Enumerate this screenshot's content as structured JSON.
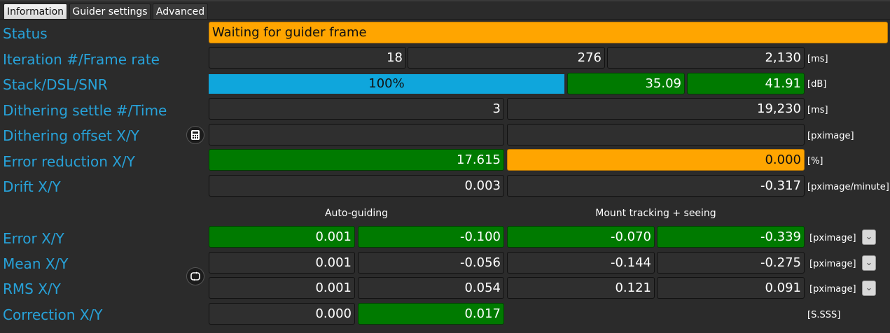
{
  "tabs": [
    "Information",
    "Guider settings",
    "Advanced"
  ],
  "labels": {
    "status": "Status",
    "iteration": "Iteration #/Frame rate",
    "stack": "Stack/DSL/SNR",
    "dither_settle": "Dithering settle #/Time",
    "dither_offset": "Dithering offset X/Y",
    "error_reduction": "Error reduction X/Y",
    "drift": "Drift X/Y",
    "error": "Error X/Y",
    "mean": "Mean X/Y",
    "rms": "RMS X/Y",
    "correction": "Correction X/Y"
  },
  "status_text": "Waiting for guider frame",
  "iteration": {
    "iteration": "18",
    "frame": "276",
    "time": "2,130",
    "unit": "[ms]"
  },
  "stack": {
    "progress_text": "100%",
    "progress_fraction": 1.0,
    "dsl": "35.09",
    "snr": "41.91",
    "unit": "[dB]"
  },
  "dither_settle": {
    "count": "3",
    "time": "19,230",
    "unit": "[ms]"
  },
  "dither_offset": {
    "x": "",
    "y": "",
    "unit": "[pximage]"
  },
  "error_reduction": {
    "x": "17.615",
    "y": "0.000",
    "unit": "[%]"
  },
  "drift": {
    "x": "0.003",
    "y": "-0.317",
    "unit": "[pximage/minute]"
  },
  "column_headers": {
    "auto_guiding": "Auto-guiding",
    "mount_tracking": "Mount tracking + seeing"
  },
  "error": {
    "ag_x": "0.001",
    "ag_y": "-0.100",
    "mt_x": "-0.070",
    "mt_y": "-0.339",
    "unit": "[pximage]"
  },
  "mean": {
    "ag_x": "0.001",
    "ag_y": "-0.056",
    "mt_x": "-0.144",
    "mt_y": "-0.275",
    "unit": "[pximage]"
  },
  "rms": {
    "ag_x": "0.001",
    "ag_y": "0.054",
    "mt_x": "0.121",
    "mt_y": "0.091",
    "unit": "[pximage]"
  },
  "correction": {
    "x": "0.000",
    "y": "0.017",
    "unit": "[S.SSS]"
  },
  "icons": {
    "dither_calc": "calculator-icon",
    "reset": "reset-icon",
    "dropdown": "chevron-down-icon"
  },
  "colors": {
    "label": "#27a2d9",
    "green": "#007a00",
    "orange": "#ffa500",
    "progress": "#0fa6dc"
  }
}
